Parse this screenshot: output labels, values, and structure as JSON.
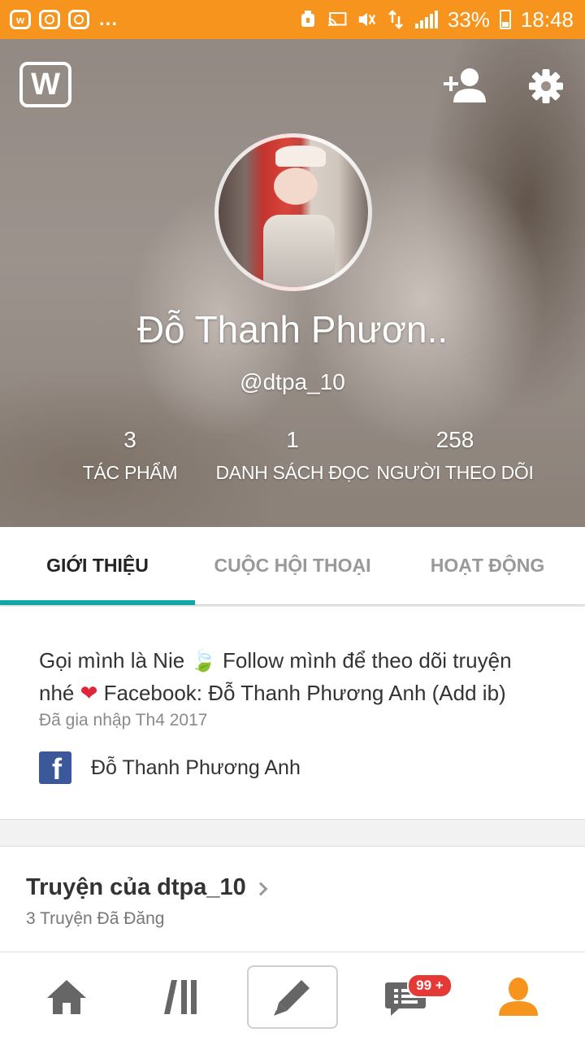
{
  "status_bar": {
    "battery_percent": "33%",
    "time": "18:48",
    "overflow": "..."
  },
  "header": {
    "logo_letter": "W",
    "display_name": "Đỗ Thanh Phươn..",
    "username": "@dtpa_10",
    "stats": [
      {
        "value": "3",
        "label": "TÁC PHẨM"
      },
      {
        "value": "1",
        "label": "DANH SÁCH ĐỌC"
      },
      {
        "value": "258",
        "label": "NGƯỜI THEO DÕI"
      }
    ]
  },
  "tabs": [
    {
      "label": "GIỚI THIỆU",
      "active": true
    },
    {
      "label": "CUỘC HỘI THOẠI",
      "active": false
    },
    {
      "label": "HOẠT ĐỘNG",
      "active": false
    }
  ],
  "about": {
    "bio_part1": "Gọi mình là Nie 🍃 Follow mình để theo dõi truyện nhé ",
    "heart": "❤",
    "bio_part2": " Facebook: Đỗ Thanh Phương Anh (Add ib)",
    "joined": "Đã gia nhập Th4 2017",
    "facebook_letter": "f",
    "facebook_name": "Đỗ Thanh Phương Anh"
  },
  "stories": {
    "title": "Truyện của dtpa_10",
    "subtitle": "3 Truyện Đã Đăng"
  },
  "bottom_nav": {
    "notification_badge": "99 +"
  },
  "colors": {
    "status_bar": "#f7941e",
    "tab_indicator": "#12a6a3",
    "profile_active": "#f7941e",
    "facebook": "#3b5998",
    "badge": "#e53935"
  },
  "icons": [
    "wattpad-icon",
    "instagram-icon",
    "cast-icon",
    "mute-icon",
    "signal-icon",
    "battery-icon",
    "add-friend-icon",
    "gear-icon",
    "facebook-icon",
    "chevron-right-icon",
    "home-icon",
    "library-icon",
    "pencil-icon",
    "messages-icon",
    "profile-icon"
  ]
}
